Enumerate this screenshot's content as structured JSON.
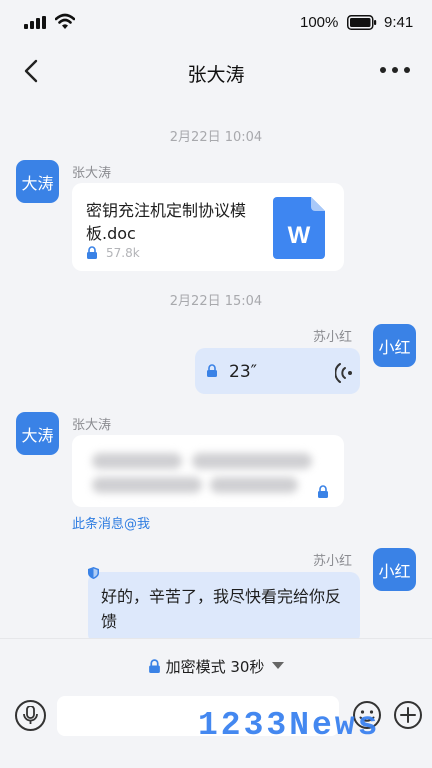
{
  "status_bar": {
    "battery_percent": "100%",
    "time": "9:41"
  },
  "header": {
    "title": "张大涛"
  },
  "messages": [
    {
      "type": "timestamp",
      "text": "2月22日 10:04"
    },
    {
      "type": "file",
      "avatar_text": "大涛",
      "sender": "张大涛",
      "file_name": "密钥充注机定制协议模板.doc",
      "file_size": "57.8k",
      "file_icon_letter": "W"
    },
    {
      "type": "timestamp",
      "text": "2月22日 15:04"
    },
    {
      "type": "voice",
      "avatar_text": "小红",
      "sender": "苏小红",
      "duration": "23″"
    },
    {
      "type": "blurred",
      "avatar_text": "大涛",
      "sender": "张大涛",
      "mention": "此条消息@我"
    },
    {
      "type": "text",
      "avatar_text": "小红",
      "sender": "苏小红",
      "text": "好的，辛苦了，我尽快看完给你反馈"
    }
  ],
  "input_bar": {
    "mode_label": "加密模式 30秒",
    "input_value": "",
    "watermark": "1233News"
  },
  "colors": {
    "accent": "#3a82e6",
    "self_bubble": "#dde8fb",
    "background": "#f3f4f7"
  },
  "icons": [
    "signal-icon",
    "wifi-icon",
    "battery-icon",
    "back-icon",
    "more-icon",
    "lock-icon",
    "word-file-icon",
    "voice-wave-icon",
    "shield-icon",
    "microphone-icon",
    "emoji-icon",
    "plus-icon",
    "caret-down-icon"
  ]
}
